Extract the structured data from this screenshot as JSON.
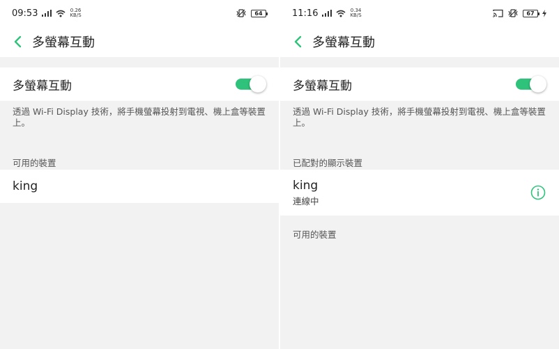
{
  "colors": {
    "accent": "#2fc27a",
    "background": "#f2f2f2",
    "surface": "#ffffff"
  },
  "left_screen": {
    "status": {
      "time": "09:53",
      "speed_value": "0.26",
      "speed_unit": "KB/S",
      "battery": "64"
    },
    "header": {
      "title": "多螢幕互動",
      "back_icon": "chevron-left-icon"
    },
    "toggle": {
      "label": "多螢幕互動",
      "enabled": true
    },
    "description": "透過 Wi-Fi Display 技術，將手機螢幕投射到電視、機上盒等裝置上。",
    "available_section": "可用的裝置",
    "available_devices": [
      {
        "name": "king"
      }
    ]
  },
  "right_screen": {
    "status": {
      "time": "11:16",
      "speed_value": "0.34",
      "speed_unit": "KB/S",
      "battery": "67"
    },
    "header": {
      "title": "多螢幕互動",
      "back_icon": "chevron-left-icon"
    },
    "toggle": {
      "label": "多螢幕互動",
      "enabled": true
    },
    "description": "透過 Wi-Fi Display 技術，將手機螢幕投射到電視、機上盒等裝置上。",
    "paired_section": "已配對的顯示裝置",
    "paired_devices": [
      {
        "name": "king",
        "status": "連線中",
        "info_icon": "info-icon"
      }
    ],
    "available_section": "可用的裝置"
  }
}
